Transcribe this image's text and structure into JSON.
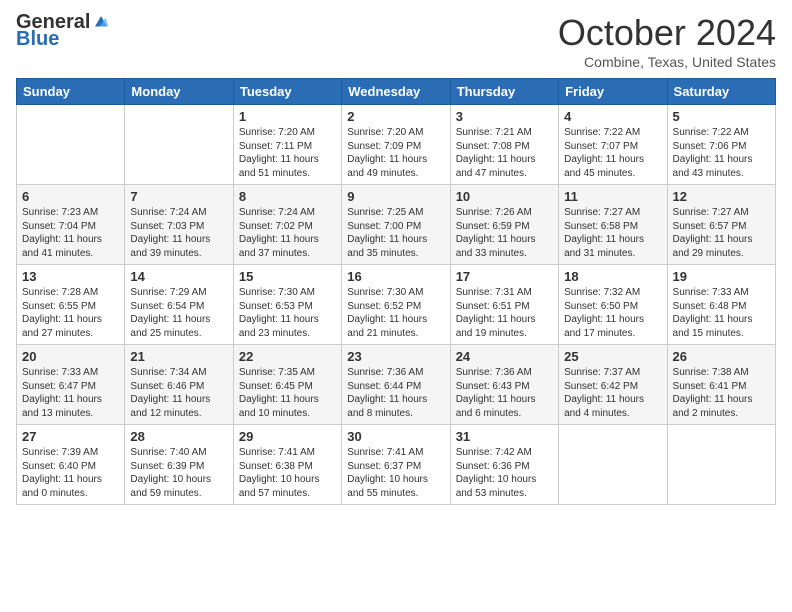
{
  "header": {
    "logo_general": "General",
    "logo_blue": "Blue",
    "month_title": "October 2024",
    "location": "Combine, Texas, United States"
  },
  "weekdays": [
    "Sunday",
    "Monday",
    "Tuesday",
    "Wednesday",
    "Thursday",
    "Friday",
    "Saturday"
  ],
  "weeks": [
    [
      {
        "day": "",
        "info": ""
      },
      {
        "day": "",
        "info": ""
      },
      {
        "day": "1",
        "info": "Sunrise: 7:20 AM\nSunset: 7:11 PM\nDaylight: 11 hours and 51 minutes."
      },
      {
        "day": "2",
        "info": "Sunrise: 7:20 AM\nSunset: 7:09 PM\nDaylight: 11 hours and 49 minutes."
      },
      {
        "day": "3",
        "info": "Sunrise: 7:21 AM\nSunset: 7:08 PM\nDaylight: 11 hours and 47 minutes."
      },
      {
        "day": "4",
        "info": "Sunrise: 7:22 AM\nSunset: 7:07 PM\nDaylight: 11 hours and 45 minutes."
      },
      {
        "day": "5",
        "info": "Sunrise: 7:22 AM\nSunset: 7:06 PM\nDaylight: 11 hours and 43 minutes."
      }
    ],
    [
      {
        "day": "6",
        "info": "Sunrise: 7:23 AM\nSunset: 7:04 PM\nDaylight: 11 hours and 41 minutes."
      },
      {
        "day": "7",
        "info": "Sunrise: 7:24 AM\nSunset: 7:03 PM\nDaylight: 11 hours and 39 minutes."
      },
      {
        "day": "8",
        "info": "Sunrise: 7:24 AM\nSunset: 7:02 PM\nDaylight: 11 hours and 37 minutes."
      },
      {
        "day": "9",
        "info": "Sunrise: 7:25 AM\nSunset: 7:00 PM\nDaylight: 11 hours and 35 minutes."
      },
      {
        "day": "10",
        "info": "Sunrise: 7:26 AM\nSunset: 6:59 PM\nDaylight: 11 hours and 33 minutes."
      },
      {
        "day": "11",
        "info": "Sunrise: 7:27 AM\nSunset: 6:58 PM\nDaylight: 11 hours and 31 minutes."
      },
      {
        "day": "12",
        "info": "Sunrise: 7:27 AM\nSunset: 6:57 PM\nDaylight: 11 hours and 29 minutes."
      }
    ],
    [
      {
        "day": "13",
        "info": "Sunrise: 7:28 AM\nSunset: 6:55 PM\nDaylight: 11 hours and 27 minutes."
      },
      {
        "day": "14",
        "info": "Sunrise: 7:29 AM\nSunset: 6:54 PM\nDaylight: 11 hours and 25 minutes."
      },
      {
        "day": "15",
        "info": "Sunrise: 7:30 AM\nSunset: 6:53 PM\nDaylight: 11 hours and 23 minutes."
      },
      {
        "day": "16",
        "info": "Sunrise: 7:30 AM\nSunset: 6:52 PM\nDaylight: 11 hours and 21 minutes."
      },
      {
        "day": "17",
        "info": "Sunrise: 7:31 AM\nSunset: 6:51 PM\nDaylight: 11 hours and 19 minutes."
      },
      {
        "day": "18",
        "info": "Sunrise: 7:32 AM\nSunset: 6:50 PM\nDaylight: 11 hours and 17 minutes."
      },
      {
        "day": "19",
        "info": "Sunrise: 7:33 AM\nSunset: 6:48 PM\nDaylight: 11 hours and 15 minutes."
      }
    ],
    [
      {
        "day": "20",
        "info": "Sunrise: 7:33 AM\nSunset: 6:47 PM\nDaylight: 11 hours and 13 minutes."
      },
      {
        "day": "21",
        "info": "Sunrise: 7:34 AM\nSunset: 6:46 PM\nDaylight: 11 hours and 12 minutes."
      },
      {
        "day": "22",
        "info": "Sunrise: 7:35 AM\nSunset: 6:45 PM\nDaylight: 11 hours and 10 minutes."
      },
      {
        "day": "23",
        "info": "Sunrise: 7:36 AM\nSunset: 6:44 PM\nDaylight: 11 hours and 8 minutes."
      },
      {
        "day": "24",
        "info": "Sunrise: 7:36 AM\nSunset: 6:43 PM\nDaylight: 11 hours and 6 minutes."
      },
      {
        "day": "25",
        "info": "Sunrise: 7:37 AM\nSunset: 6:42 PM\nDaylight: 11 hours and 4 minutes."
      },
      {
        "day": "26",
        "info": "Sunrise: 7:38 AM\nSunset: 6:41 PM\nDaylight: 11 hours and 2 minutes."
      }
    ],
    [
      {
        "day": "27",
        "info": "Sunrise: 7:39 AM\nSunset: 6:40 PM\nDaylight: 11 hours and 0 minutes."
      },
      {
        "day": "28",
        "info": "Sunrise: 7:40 AM\nSunset: 6:39 PM\nDaylight: 10 hours and 59 minutes."
      },
      {
        "day": "29",
        "info": "Sunrise: 7:41 AM\nSunset: 6:38 PM\nDaylight: 10 hours and 57 minutes."
      },
      {
        "day": "30",
        "info": "Sunrise: 7:41 AM\nSunset: 6:37 PM\nDaylight: 10 hours and 55 minutes."
      },
      {
        "day": "31",
        "info": "Sunrise: 7:42 AM\nSunset: 6:36 PM\nDaylight: 10 hours and 53 minutes."
      },
      {
        "day": "",
        "info": ""
      },
      {
        "day": "",
        "info": ""
      }
    ]
  ]
}
